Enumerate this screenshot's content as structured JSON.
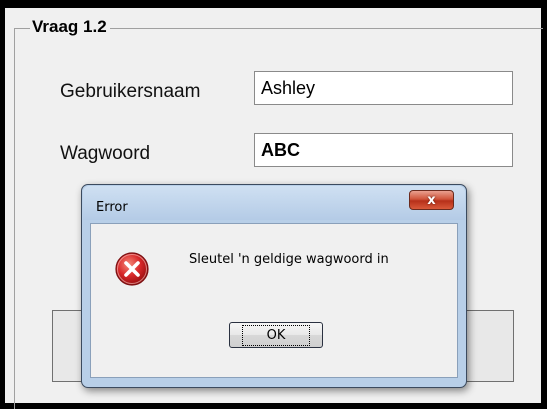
{
  "form": {
    "group_title": "Vraag 1.2",
    "username_label": "Gebruikersnaam",
    "username_value": "Ashley",
    "password_label": "Wagwoord",
    "password_value": "ABC"
  },
  "dialog": {
    "title": "Error",
    "close_label": "x",
    "message": "Sleutel 'n geldige wagwoord in",
    "ok_label": "OK",
    "icon": "error-icon"
  }
}
